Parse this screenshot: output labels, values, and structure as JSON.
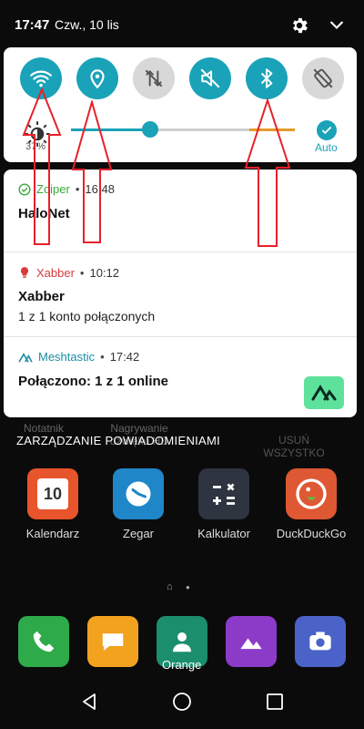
{
  "status_bar": {
    "time": "17:47",
    "date": "Czw., 10 lis"
  },
  "quick_settings": {
    "tiles": [
      {
        "name": "wifi",
        "active": true
      },
      {
        "name": "location",
        "active": true
      },
      {
        "name": "mobile-data",
        "active": false
      },
      {
        "name": "sound-off",
        "active": true
      },
      {
        "name": "bluetooth",
        "active": true
      },
      {
        "name": "auto-rotate",
        "active": false
      }
    ],
    "brightness": {
      "percent_label": "37%",
      "level": 0.37,
      "auto_label": "Auto"
    }
  },
  "notifications": [
    {
      "app": "Zoiper",
      "time": "16:48",
      "title": "HaloNet",
      "text": "",
      "app_color": "#3aa83a"
    },
    {
      "app": "Xabber",
      "time": "10:12",
      "title": "Xabber",
      "text": "1 z 1 konto połączonych",
      "app_color": "#d83a3a"
    },
    {
      "app": "Meshtastic",
      "time": "17:42",
      "title": "Połączono: 1 z 1 online",
      "text": "",
      "app_color": "#1a8fa3"
    }
  ],
  "notification_actions": {
    "manage": "ZARZĄDZANIE POWIADOMIENIAMI",
    "clear_all": "USUŃ WSZYSTKO"
  },
  "background_ghost_labels": [
    "Notatnik",
    "Nagrywanie dźwięku HD"
  ],
  "home_apps": [
    {
      "label": "Kalendarz",
      "calendar_day": "10"
    },
    {
      "label": "Zegar"
    },
    {
      "label": "Kalkulator"
    },
    {
      "label": "DuckDuckGo"
    }
  ],
  "dock": {
    "label": "Orange"
  },
  "colors": {
    "accent": "#1aa3b8",
    "annotation_arrow": "#e8202a"
  }
}
